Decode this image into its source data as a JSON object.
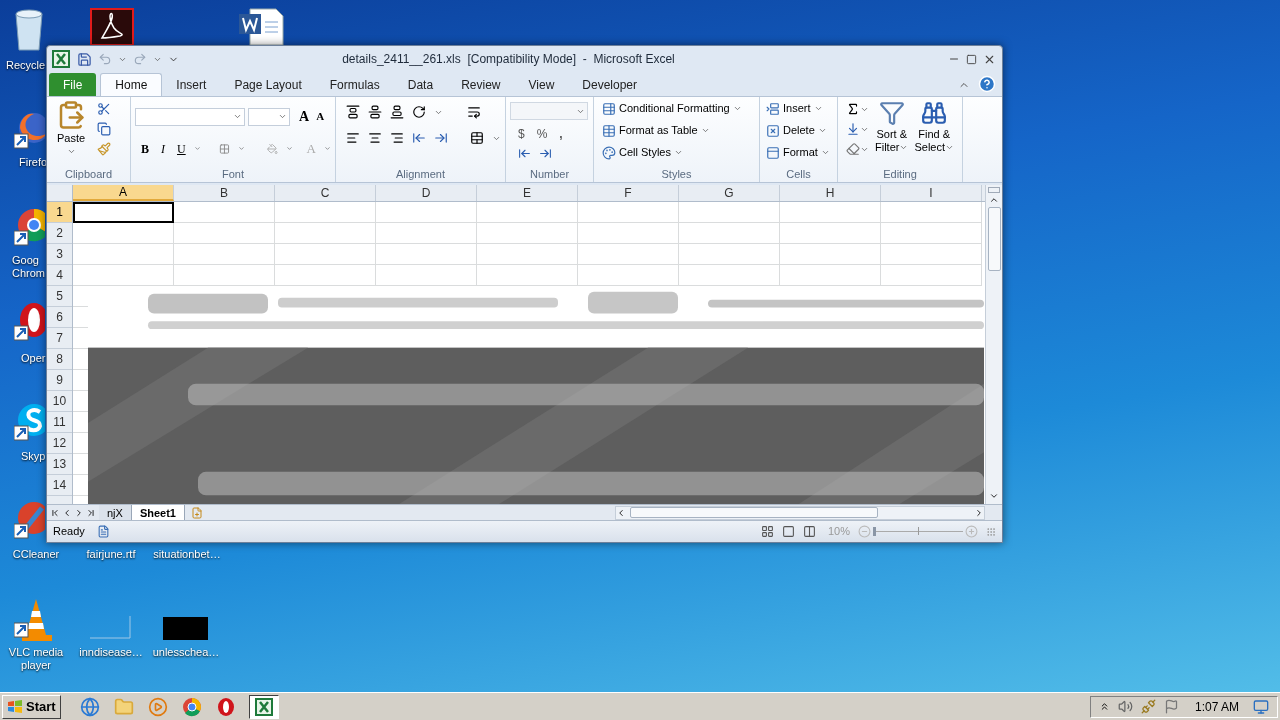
{
  "desktop_icons": [
    {
      "kind": "recycle",
      "label": "Recycle"
    },
    {
      "kind": "firefox",
      "label": "Firefo"
    },
    {
      "kind": "chrome",
      "label": "Goog\nChrom"
    },
    {
      "kind": "opera",
      "label": "Oper"
    },
    {
      "kind": "skype",
      "label": "Skyp"
    },
    {
      "kind": "ccleaner",
      "label": "CCleaner"
    },
    {
      "kind": "covered",
      "label": "fairjune.rtf"
    },
    {
      "kind": "covered",
      "label": "situationbet…"
    },
    {
      "kind": "vlc",
      "label": "VLC media\nplayer"
    },
    {
      "kind": "blank",
      "label": "inndisease…"
    },
    {
      "kind": "black",
      "label": "unlesschea…"
    },
    {
      "kind": "acrobat"
    },
    {
      "kind": "word"
    }
  ],
  "window": {
    "title": "details_2411__261.xls  [Compatibility Mode]  -  Microsoft Excel"
  },
  "ribbon_tabs": [
    {
      "label": "File",
      "kind": "file",
      "selected": false
    },
    {
      "label": "Home",
      "kind": "tab",
      "selected": true
    },
    {
      "label": "Insert",
      "kind": "tab",
      "selected": false
    },
    {
      "label": "Page Layout",
      "kind": "tab",
      "selected": false
    },
    {
      "label": "Formulas",
      "kind": "tab",
      "selected": false
    },
    {
      "label": "Data",
      "kind": "tab",
      "selected": false
    },
    {
      "label": "Review",
      "kind": "tab",
      "selected": false
    },
    {
      "label": "View",
      "kind": "tab",
      "selected": false
    },
    {
      "label": "Developer",
      "kind": "tab",
      "selected": false
    }
  ],
  "clipboard": {
    "label": "Clipboard",
    "paste": "Paste"
  },
  "font": {
    "label": "Font",
    "grow": "A",
    "shrink": "A",
    "bold": "B",
    "italic": "I",
    "underline": "U",
    "text_color": "A"
  },
  "alignment": {
    "label": "Alignment"
  },
  "number": {
    "label": "Number",
    "currency": "$",
    "percent": "%",
    "comma": ","
  },
  "styles": {
    "label": "Styles",
    "items": [
      "Conditional Formatting",
      "Format as Table",
      "Cell Styles"
    ]
  },
  "cells": {
    "label": "Cells",
    "items": [
      "Insert",
      "Delete",
      "Format"
    ]
  },
  "editing": {
    "label": "Editing",
    "sort": [
      "Sort &",
      "Filter"
    ],
    "find": [
      "Find &",
      "Select"
    ]
  },
  "columns": [
    {
      "label": "A",
      "selected": true
    },
    {
      "label": "B",
      "selected": false
    },
    {
      "label": "C",
      "selected": false
    },
    {
      "label": "D",
      "selected": false
    },
    {
      "label": "E",
      "selected": false
    },
    {
      "label": "F",
      "selected": false
    },
    {
      "label": "G",
      "selected": false
    },
    {
      "label": "H",
      "selected": false
    },
    {
      "label": "I",
      "selected": false
    }
  ],
  "rows": [
    {
      "label": "1",
      "selected": true
    },
    {
      "label": "2",
      "selected": false
    },
    {
      "label": "3",
      "selected": false
    },
    {
      "label": "4",
      "selected": false
    },
    {
      "label": "5",
      "selected": false
    },
    {
      "label": "6",
      "selected": false
    },
    {
      "label": "7",
      "selected": false
    },
    {
      "label": "8",
      "selected": false
    },
    {
      "label": "9",
      "selected": false
    },
    {
      "label": "10",
      "selected": false
    },
    {
      "label": "11",
      "selected": false
    },
    {
      "label": "12",
      "selected": false
    },
    {
      "label": "13",
      "selected": false
    },
    {
      "label": "14",
      "selected": false
    }
  ],
  "sheet_tabs": [
    {
      "label": "njX",
      "selected": false
    },
    {
      "label": "Sheet1",
      "selected": true
    }
  ],
  "status_bar": {
    "text": "Ready",
    "zoom": "10%",
    "zoom_slider": {
      "level": 0.0
    }
  },
  "taskbar": {
    "start": "Start",
    "apps": [
      {
        "kind": "ie",
        "selected": false
      },
      {
        "kind": "explorer",
        "selected": false
      },
      {
        "kind": "media",
        "selected": false
      },
      {
        "kind": "chrome",
        "selected": false
      },
      {
        "kind": "opera",
        "selected": false
      },
      {
        "kind": "excel",
        "selected": true
      }
    ],
    "clock": "1:07 AM"
  }
}
